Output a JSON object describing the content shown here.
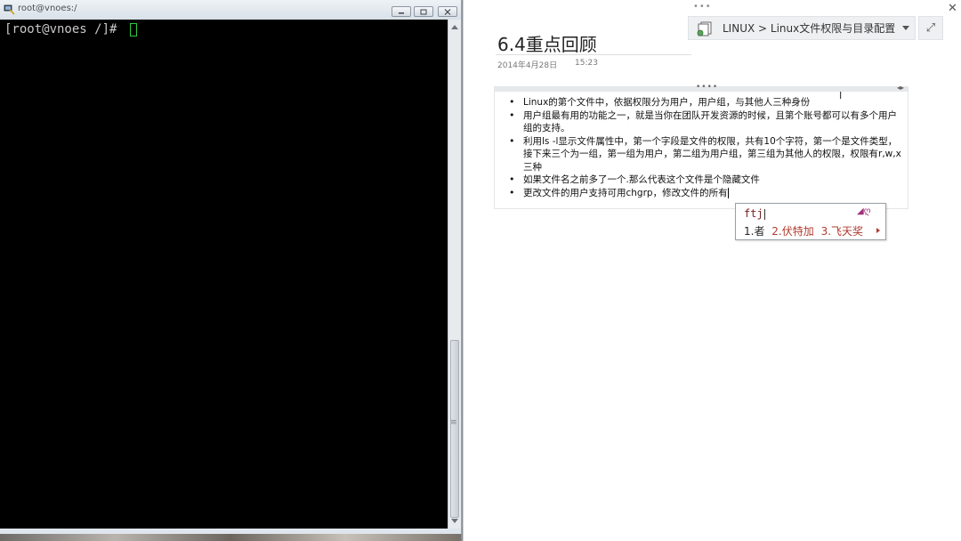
{
  "terminal": {
    "title": "root@vnoes:/",
    "prompt": "[root@vnoes /]# "
  },
  "notes": {
    "breadcrumb": "LINUX > Linux文件权限与目录配置",
    "page": {
      "title": "6.4重点回顾",
      "date": "2014年4月28日",
      "time": "15:23"
    },
    "bullets": [
      "Linux的第个文件中，依据权限分为用户，用户组，与其他人三种身份",
      "用户组最有用的功能之一，就是当你在团队开发资源的时候，且第个账号都可以有多个用户组的支持。",
      "利用ls -l显示文件属性中，第一个字段是文件的权限，共有10个字符，第一个是文件类型，接下来三个为一组，第一组为用户，第二组为用户组，第三组为其他人的权限，权限有r,w,x三种",
      "如果文件名之前多了一个.那么代表这个文件是个隐藏文件",
      "更改文件的用户支持可用chgrp，修改文件的所有"
    ]
  },
  "ime": {
    "pinyin": "ftj",
    "candidates": [
      "1.者",
      "2.伏特加",
      "3.飞天奖"
    ]
  },
  "colors": {
    "terminal_bg": "#000000",
    "cursor": "#2ecc40",
    "candidate_accent": "#b03a2e"
  },
  "icons": [
    "putty-icon",
    "minimize-icon",
    "maximize-icon",
    "close-icon",
    "notebook-icon",
    "dropdown-icon",
    "expand-icon",
    "text-cursor-icon"
  ]
}
